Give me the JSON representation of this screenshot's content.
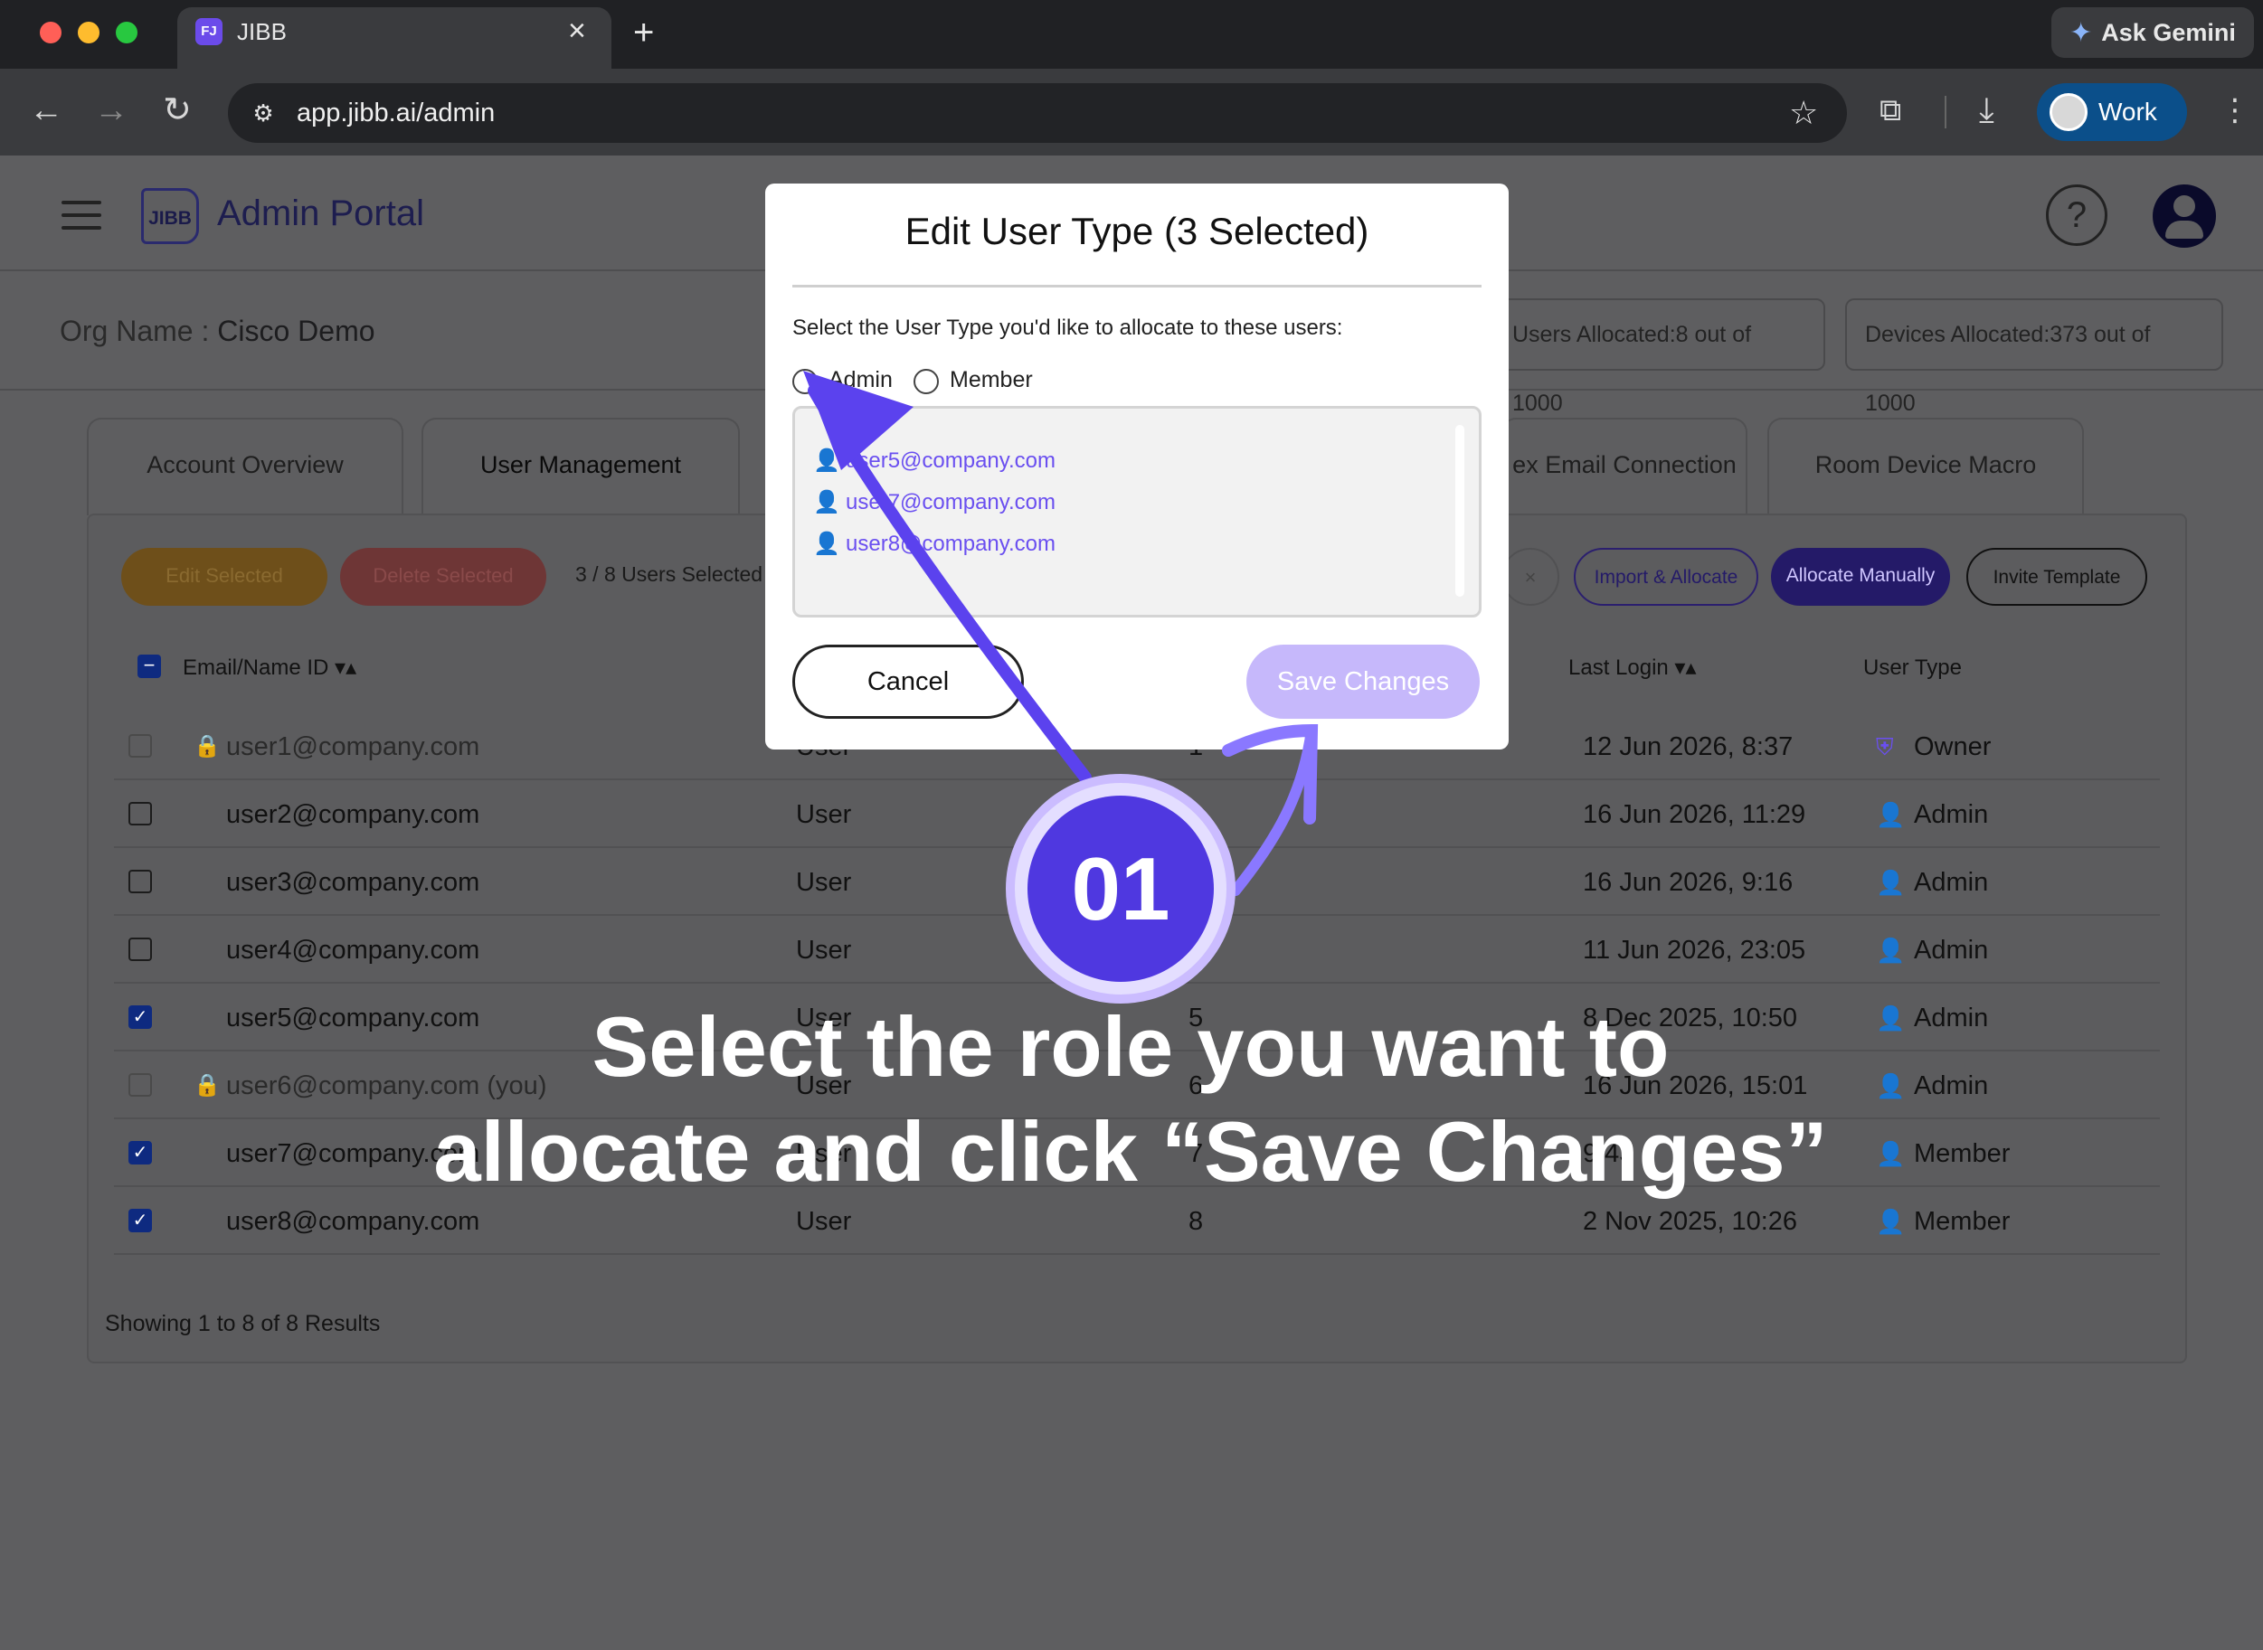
{
  "browser": {
    "tab_title": "JIBB",
    "tab_favicon": "FJ",
    "url": "app.jibb.ai/admin",
    "gemini_label": "Ask Gemini",
    "profile_label": "Work"
  },
  "header": {
    "logo_text": "JIBB",
    "title": "Admin Portal"
  },
  "org": {
    "label": "Org Name : ",
    "name": "Cisco Demo",
    "users_allocated_label": "Users Allocated:",
    "users_allocated_value": "8 out of 1000",
    "devices_allocated_label": "Devices Allocated:",
    "devices_allocated_value": "373 out of 1000"
  },
  "tabs": [
    {
      "label": "Account Overview"
    },
    {
      "label": "User Management"
    },
    {
      "label": "ex Email Connection"
    },
    {
      "label": "Room Device Macro"
    }
  ],
  "actions": {
    "edit_selected": "Edit Selected",
    "delete_selected": "Delete Selected",
    "selection_count": "3 / 8 Users Selected",
    "import_allocate": "Import & Allocate",
    "allocate_manually": "Allocate Manually",
    "invite_template": "Invite Template"
  },
  "table": {
    "headers": {
      "email": "Email/Name ID",
      "last_login": "Last Login",
      "user_type": "User Type"
    },
    "rows": [
      {
        "email": "user1@company.com",
        "role": "User",
        "num": "1",
        "last_login": "12 Jun 2026, 8:37",
        "type": "Owner"
      },
      {
        "email": "user2@company.com",
        "role": "User",
        "num": "",
        "last_login": "16 Jun 2026, 11:29",
        "type": "Admin"
      },
      {
        "email": "user3@company.com",
        "role": "User",
        "num": "",
        "last_login": "16 Jun 2026, 9:16",
        "type": "Admin"
      },
      {
        "email": "user4@company.com",
        "role": "User",
        "num": "",
        "last_login": "11 Jun 2026, 23:05",
        "type": "Admin"
      },
      {
        "email": "user5@company.com",
        "role": "User",
        "num": "5",
        "last_login": "8 Dec 2025, 10:50",
        "type": "Admin"
      },
      {
        "email": "user6@company.com (you)",
        "role": "User",
        "num": "6",
        "last_login": "16 Jun 2026, 15:01",
        "type": "Admin"
      },
      {
        "email": "user7@company.com",
        "role": "User",
        "num": "7",
        "last_login": "9:43",
        "type": "Member"
      },
      {
        "email": "user8@company.com",
        "role": "User",
        "num": "8",
        "last_login": "2 Nov 2025, 10:26",
        "type": "Member"
      }
    ],
    "footer": "Showing 1 to 8 of 8 Results"
  },
  "modal": {
    "title": "Edit User Type (3 Selected)",
    "prompt": "Select the User Type you'd like to allocate to these users:",
    "option_admin": "Admin",
    "option_member": "Member",
    "selected_users": [
      "user5@company.com",
      "user7@company.com",
      "user8@company.com"
    ],
    "cancel": "Cancel",
    "save": "Save Changes"
  },
  "annotation": {
    "step": "01",
    "caption_line1": "Select the role you want to",
    "caption_line2": "allocate and click “Save Changes”"
  },
  "colors": {
    "accent": "#4f38e0",
    "edit": "#c1801a",
    "delete": "#c64545",
    "member_icon": "#2e9e63",
    "admin_icon": "#d49a24",
    "owner_icon": "#6a4ff0"
  }
}
